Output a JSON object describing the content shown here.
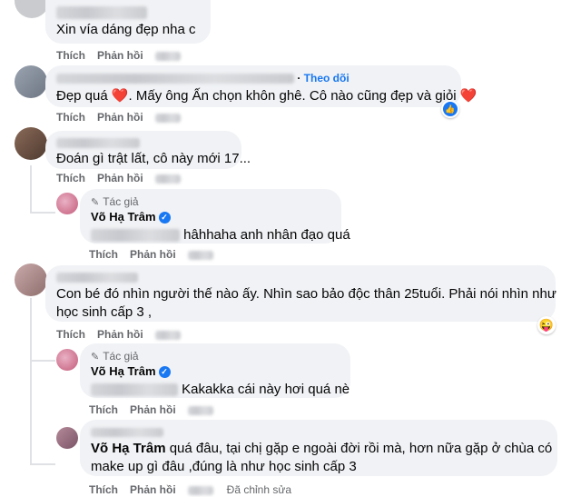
{
  "actions": {
    "like": "Thích",
    "reply": "Phản hồi",
    "edited": "Đã chỉnh sửa"
  },
  "comments": [
    {
      "text": "Xin vía dáng đẹp nha c"
    },
    {
      "follow": "Theo dõi",
      "text": "Đẹp quá ❤️. Mấy ông Ấn chọn khôn ghê. Cô nào cũng đẹp và giỏi ❤️",
      "heart": "❤"
    },
    {
      "text": "Đoán gì trật lất, cô này mới 17..."
    },
    {
      "author_tag": "Tác giả",
      "name": "Võ Hạ Trâm",
      "text": "hâhhaha anh nhân đạo quá"
    },
    {
      "text_line1": "Con bé đó nhìn người thế nào ấy. Nhìn sao bảo độc thân 25tuổi. Phải nói nhìn như",
      "text_line2": "học sinh cấp 3 ,"
    },
    {
      "author_tag": "Tác giả",
      "name": "Võ Hạ Trâm",
      "text": "Kakakka cái này hơi quá nè"
    },
    {
      "mention": "Võ Hạ Trâm",
      "text_line1": " quá đâu, tại chị gặp e ngoài đời rồi mà, hơn nữa gặp ở chùa có",
      "text_line2": "make up gì đâu ,đúng là như học sinh cấp 3"
    }
  ]
}
